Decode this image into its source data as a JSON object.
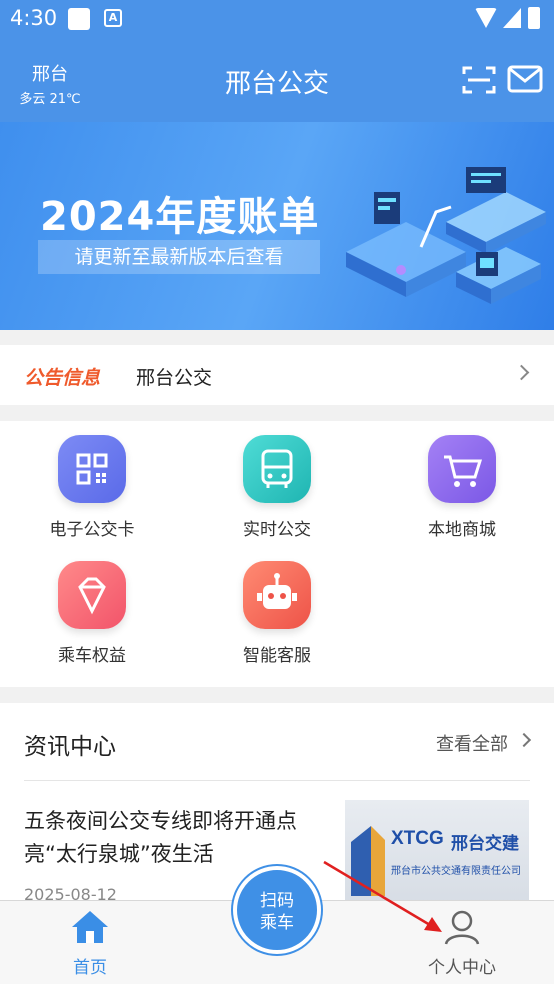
{
  "status_bar": {
    "time": "4:30",
    "a_icon": "A"
  },
  "header": {
    "city": "邢台",
    "weather": "多云 21℃",
    "title": "邢台公交",
    "icons": [
      "scan-icon",
      "mail-icon"
    ]
  },
  "banner": {
    "headline": "2024年度账单",
    "subtitle": "请更新至最新版本后查看"
  },
  "notice": {
    "tag": "公告信息",
    "text": "邢台公交"
  },
  "services": [
    {
      "label": "电子公交卡",
      "icon": "qr-card-icon",
      "color": "#6f7df0"
    },
    {
      "label": "实时公交",
      "icon": "bus-icon",
      "color": "#2fc7c4"
    },
    {
      "label": "本地商城",
      "icon": "cart-icon",
      "color": "#8f6cf0"
    },
    {
      "label": "乘车权益",
      "icon": "diamond-icon",
      "color": "#f56c7a"
    },
    {
      "label": "智能客服",
      "icon": "robot-icon",
      "color": "#f36a5a"
    }
  ],
  "news": {
    "heading": "资讯中心",
    "view_all": "查看全部",
    "article": {
      "title": "五条夜间公交专线即将开通点亮“太行泉城”夜生活",
      "date": "2025-08-12",
      "thumb_brand": "XTCG",
      "thumb_brand_cn": "邢台交建",
      "thumb_company": "邢台市公共交通有限责任公司"
    }
  },
  "bottom_nav": {
    "home": "首页",
    "scan": "扫码乘车",
    "scan_line1": "扫码",
    "scan_line2": "乘车",
    "me": "个人中心"
  },
  "colors": {
    "header_bg": "#4b93e8",
    "accent": "#3a8ee6",
    "notice_tag": "#ef5a2c",
    "annotation_arrow": "#e02020"
  }
}
